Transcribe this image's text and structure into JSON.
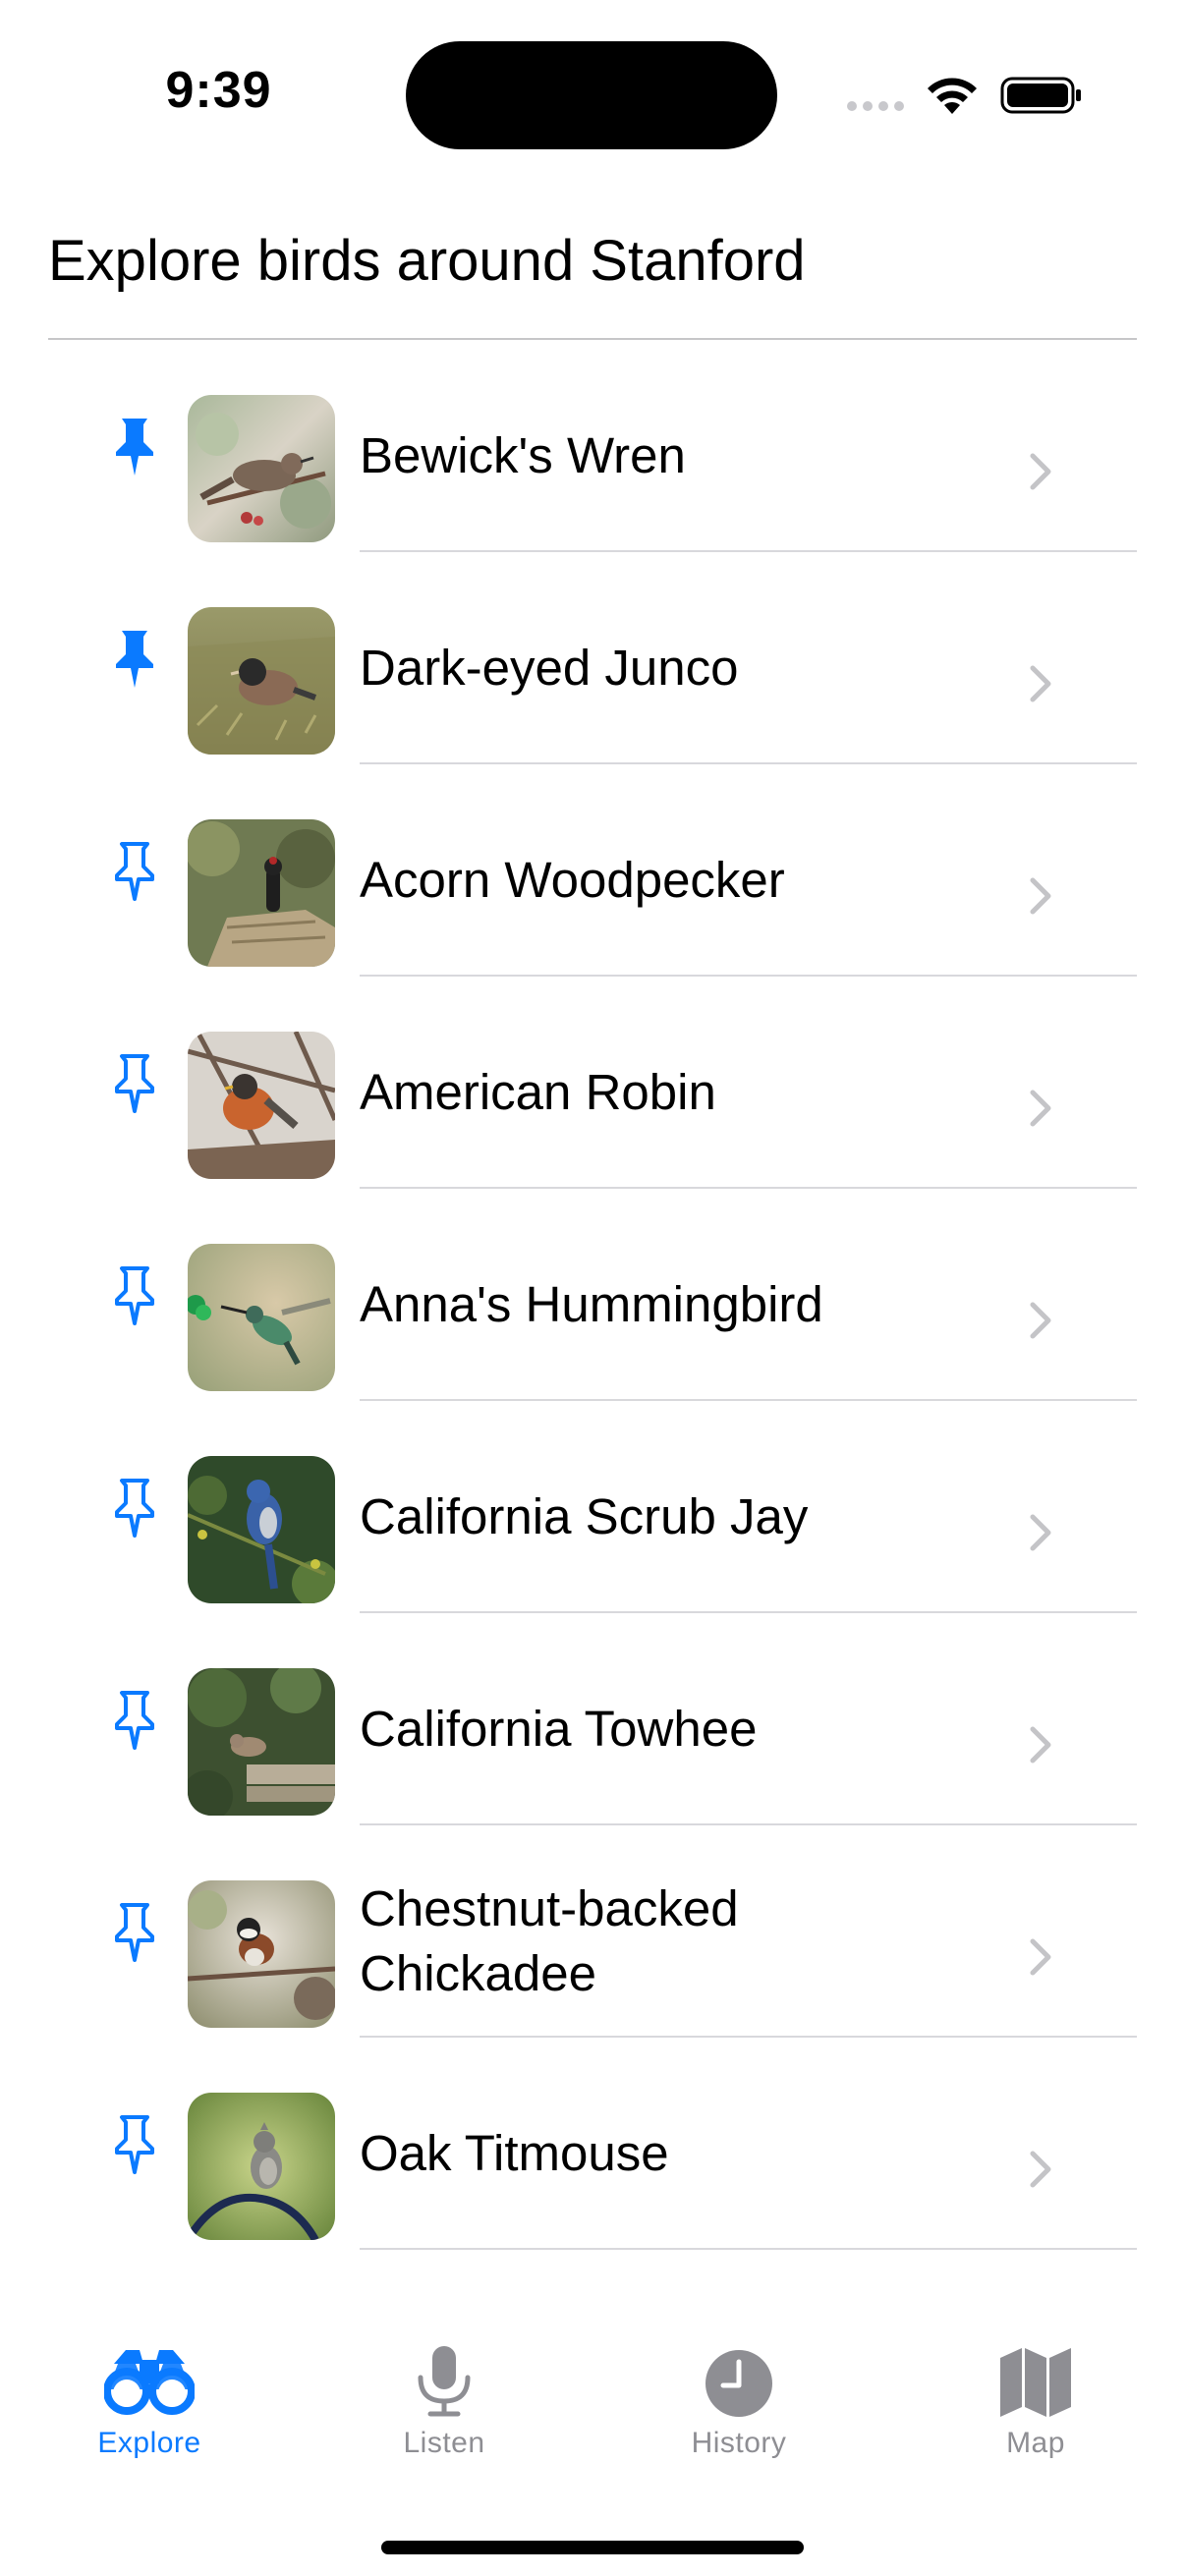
{
  "status_bar": {
    "time": "9:39"
  },
  "page": {
    "title": "Explore birds around Stanford"
  },
  "birds": [
    {
      "name": "Bewick's Wren",
      "pinned": true,
      "icon": "pin-filled-icon"
    },
    {
      "name": "Dark-eyed Junco",
      "pinned": true,
      "icon": "pin-filled-icon"
    },
    {
      "name": "Acorn Woodpecker",
      "pinned": false,
      "icon": "pin-outline-icon"
    },
    {
      "name": "American Robin",
      "pinned": false,
      "icon": "pin-outline-icon"
    },
    {
      "name": "Anna's Hummingbird",
      "pinned": false,
      "icon": "pin-outline-icon"
    },
    {
      "name": "California Scrub Jay",
      "pinned": false,
      "icon": "pin-outline-icon"
    },
    {
      "name": "California Towhee",
      "pinned": false,
      "icon": "pin-outline-icon"
    },
    {
      "name": "Chestnut-backed Chickadee",
      "pinned": false,
      "icon": "pin-outline-icon"
    },
    {
      "name": "Oak Titmouse",
      "pinned": false,
      "icon": "pin-outline-icon"
    }
  ],
  "tabs": [
    {
      "label": "Explore",
      "icon": "binoculars-icon",
      "active": true
    },
    {
      "label": "Listen",
      "icon": "microphone-icon",
      "active": false
    },
    {
      "label": "History",
      "icon": "clock-icon",
      "active": false
    },
    {
      "label": "Map",
      "icon": "map-icon",
      "active": false
    }
  ],
  "colors": {
    "accent": "#0a7aff",
    "inactive": "#8e8e93",
    "chevron": "#c4c4c7",
    "divider": "#d8d8dc"
  }
}
